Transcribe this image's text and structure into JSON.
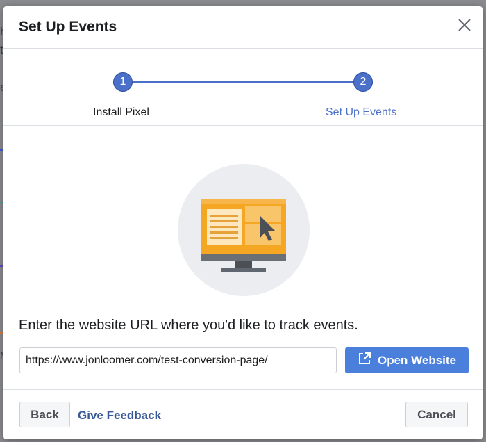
{
  "background": {
    "peek_texts": [
      "h",
      "t",
      "e",
      "M"
    ]
  },
  "modal": {
    "title": "Set Up Events",
    "close_icon": "close-icon"
  },
  "stepper": {
    "steps": [
      {
        "number": "1",
        "label": "Install Pixel",
        "state": "completed"
      },
      {
        "number": "2",
        "label": "Set Up Events",
        "state": "active"
      }
    ],
    "accent_color": "#4a70c9"
  },
  "content": {
    "illustration_icon": "computer-monitor-cursor-icon",
    "prompt": "Enter the website URL where you'd like to track events.",
    "url_value": "https://www.jonloomer.com/test-conversion-page/",
    "open_button_label": "Open Website",
    "open_button_icon": "external-link-icon",
    "open_button_color": "#4a7fdc"
  },
  "footer": {
    "back_label": "Back",
    "feedback_label": "Give Feedback",
    "cancel_label": "Cancel",
    "link_color": "#385898"
  }
}
